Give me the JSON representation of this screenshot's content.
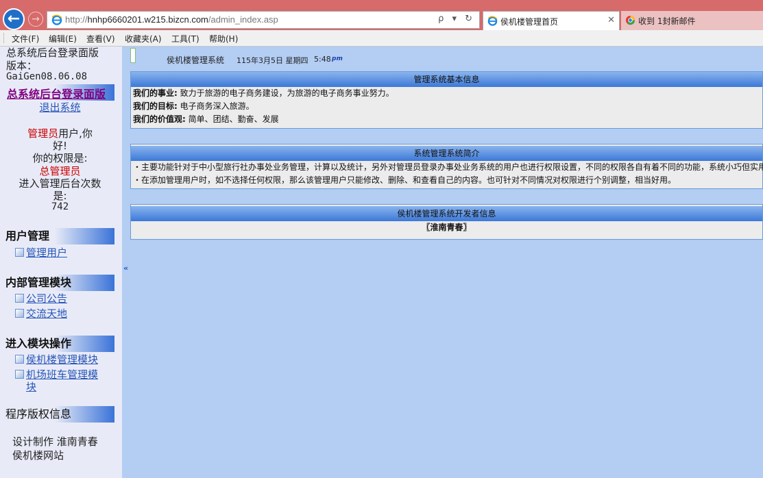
{
  "browser": {
    "url_scheme": "http://",
    "url_host": "hnhp6660201.w215.bizcn.com",
    "url_path": "/admin_index.asp",
    "search_glyph": "ρ ▾ ↻",
    "tabs": [
      {
        "label": "侯机楼管理首页",
        "close": "✕"
      },
      {
        "label": "收到 1封新邮件"
      }
    ],
    "menu": [
      "文件(F)",
      "编辑(E)",
      "查看(V)",
      "收藏夹(A)",
      "工具(T)",
      "帮助(H)"
    ]
  },
  "sidebar": {
    "title": "总系统后台登录面版",
    "version_label": "版本：",
    "version": "GaiGen08.06.08",
    "title_link": "总系统后台登录面版",
    "logout": "退出系统",
    "greeting_role": "管理员",
    "greeting_suffix": "用户,你",
    "greeting_line2": "好!",
    "perm_label": "你的权限是:",
    "perm_value": "总管理员",
    "login_label": "进入管理后台次数",
    "login_label2": "是:",
    "login_count": "742",
    "sections": [
      {
        "title": "用户管理",
        "items": [
          "管理用户"
        ]
      },
      {
        "title": "内部管理模块",
        "items": [
          "公司公告",
          "交流天地"
        ]
      },
      {
        "title": "进入模块操作",
        "items": [
          "侯机楼管理模块",
          "机场班车管理模",
          "块"
        ]
      },
      {
        "title": "程序版权信息"
      }
    ],
    "credit_line1": "设计制作  淮南青春",
    "credit_line2": "侯机楼网站",
    "collapse": "«"
  },
  "main": {
    "system_name": "侯机楼管理系统",
    "date": "115年3月5日  星期四",
    "time": "5:48",
    "ampm": "pm",
    "panels": [
      {
        "title": "管理系统基本信息",
        "rows": [
          {
            "label": "我们的事业:",
            "text": "致力于旅游的电子商务建设，为旅游的电子商务事业努力。"
          },
          {
            "label": "我们的目标:",
            "text": "电子商务深入旅游。"
          },
          {
            "label": "我们的价值观:",
            "text": "简单、团结、勤奋、发展"
          }
        ]
      },
      {
        "title": "系统管理系统简介",
        "rows": [
          {
            "text": "・主要功能针对于中小型旅行社办事处业务管理，计算以及统计，另外对管理员登录办事处业务系统的用户也进行权限设置，不同的权限各自有着不同的功能，系统小巧但实用"
          },
          {
            "text": "・在添加管理用户时，如不选择任何权限，那么该管理用户只能修改、删除、和查看自己的内容。也可针对不同情况对权限进行个别调整，相当好用。"
          }
        ]
      },
      {
        "title": "侯机楼管理系统开发者信息",
        "rows": [
          {
            "text": "〖淮南青春〗"
          }
        ]
      }
    ]
  }
}
